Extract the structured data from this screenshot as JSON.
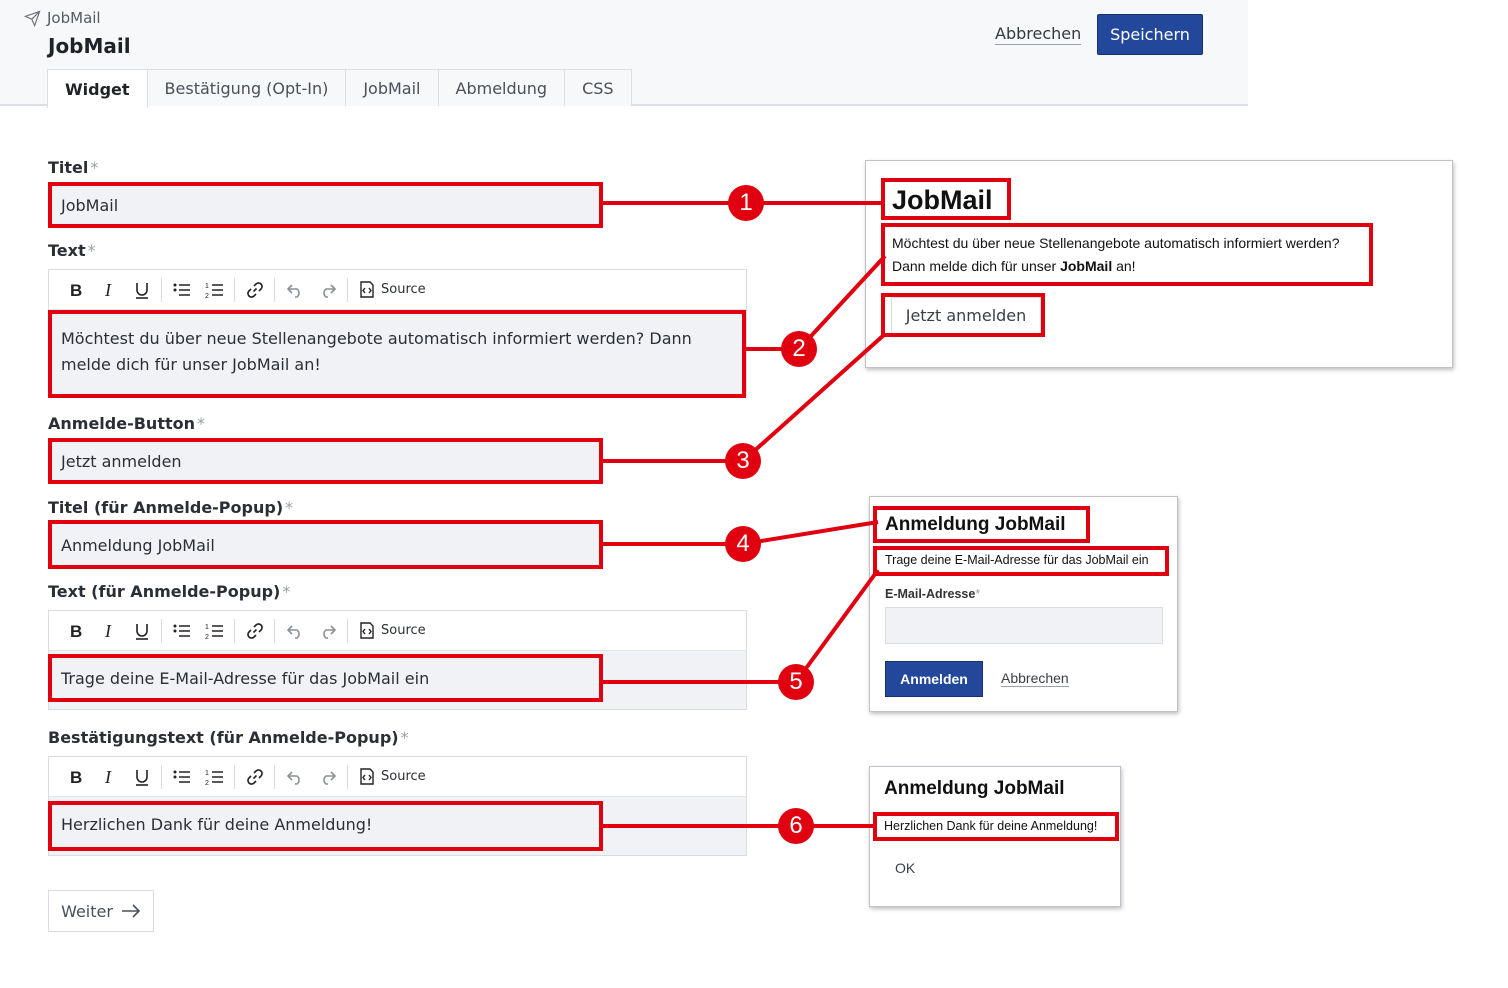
{
  "header": {
    "breadcrumb": "JobMail",
    "title": "JobMail",
    "cancel_label": "Abbrechen",
    "save_label": "Speichern"
  },
  "tabs": [
    {
      "label": "Widget",
      "active": true
    },
    {
      "label": "Bestätigung (Opt-In)",
      "active": false
    },
    {
      "label": "JobMail",
      "active": false
    },
    {
      "label": "Abmeldung",
      "active": false
    },
    {
      "label": "CSS",
      "active": false
    }
  ],
  "form": {
    "required_mark": "*",
    "title": {
      "label": "Titel",
      "value": "JobMail"
    },
    "text": {
      "label": "Text",
      "value": "Möchtest du über neue Stellenangebote automatisch informiert werden? Dann melde dich für unser JobMail an!"
    },
    "signup_button": {
      "label": "Anmelde-Button",
      "value": "Jetzt anmelden"
    },
    "popup_title": {
      "label": "Titel (für Anmelde-Popup)",
      "value": "Anmeldung JobMail"
    },
    "popup_text": {
      "label": "Text (für Anmelde-Popup)",
      "value": "Trage deine E-Mail-Adresse für das JobMail ein"
    },
    "confirm_text": {
      "label": "Bestätigungstext (für Anmelde-Popup)",
      "value": "Herzlichen Dank für deine Anmeldung!"
    },
    "next_label": "Weiter"
  },
  "toolbar": {
    "source_label": "Source",
    "icons": [
      "bold-icon",
      "italic-icon",
      "underline-icon",
      "bulleted-list-icon",
      "numbered-list-icon",
      "link-icon",
      "undo-icon",
      "redo-icon",
      "source-icon"
    ]
  },
  "markers": [
    "1",
    "2",
    "3",
    "4",
    "5",
    "6"
  ],
  "preview_widget": {
    "title": "JobMail",
    "text_line1": "Möchtest du über neue Stellenangebote automatisch informiert werden?",
    "text_line2_prefix": "Dann melde dich für unser ",
    "text_line2_bold": "JobMail",
    "text_line2_suffix": " an!",
    "button": "Jetzt anmelden"
  },
  "preview_popup": {
    "title": "Anmeldung JobMail",
    "text": "Trage deine E-Mail-Adresse für das JobMail ein",
    "email_label": "E-Mail-Adresse",
    "submit_label": "Anmelden",
    "cancel_label": "Abbrechen"
  },
  "preview_confirm": {
    "title": "Anmeldung JobMail",
    "text": "Herzlichen Dank für deine Anmeldung!",
    "ok_label": "OK"
  },
  "colors": {
    "accent": "#23479a",
    "annotation_red": "#e0000f",
    "input_bg": "#f1f2f6"
  }
}
